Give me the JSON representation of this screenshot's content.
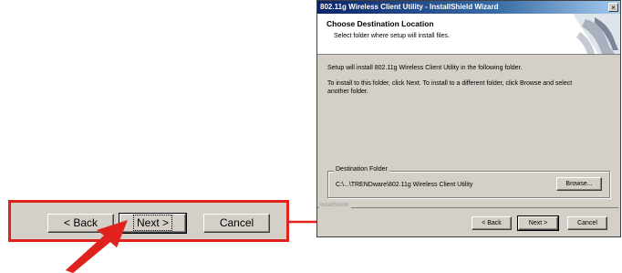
{
  "window": {
    "title": "802.11g Wireless Client Utility - InstallShield Wizard",
    "close_glyph": "×"
  },
  "header": {
    "title": "Choose Destination Location",
    "subtitle": "Select folder where setup will install files."
  },
  "body": {
    "line1": "Setup will install 802.11g Wireless Client Utility in the following folder.",
    "line2": "To install to this folder, click Next. To install to a different folder, click Browse and select",
    "line3": "another folder."
  },
  "destination": {
    "legend": "Destination Folder",
    "path": "C:\\...\\TRENDware\\802.11g Wireless Client Utility",
    "browse_label": "Browse..."
  },
  "footer": {
    "installshield_label": "InstallShield",
    "back_label": "< Back",
    "next_label": "Next >",
    "cancel_label": "Cancel"
  },
  "zoom": {
    "back_label": "< Back",
    "next_label": "Next >",
    "cancel_label": "Cancel"
  },
  "colors": {
    "highlight": "#e0221e",
    "dialog_face": "#d4d0c8",
    "title_gradient_start": "#0a246a"
  },
  "icons": [
    "close-icon",
    "wizard-header-graphic",
    "pointer-arrow-icon",
    "connector-arrow-icon"
  ]
}
